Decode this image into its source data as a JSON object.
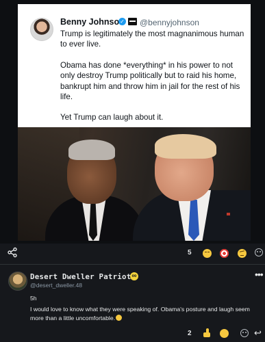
{
  "tweet": {
    "author_name": "Benny Johnson",
    "author_handle": "@bennyjohnson",
    "verified_icon": "verified-check-icon",
    "paragraphs": [
      "Trump is legitimately the most magnanimous human to ever live.",
      "Obama has done *everything* in his power to not only destroy Trump politically but to raid his home, bankrupt him and throw him in jail for the rest of his life.",
      "Yet Trump can laugh about it."
    ]
  },
  "post_actions": {
    "share_icon": "share-icon",
    "reaction_count": "5",
    "reactions": [
      "unamused-face-emoji",
      "target-emoji",
      "raised-eyebrow-emoji"
    ],
    "add_reaction_icon": "add-reaction-icon"
  },
  "comment": {
    "author_name": "Desert Dweller Patriot",
    "author_handle": "@desert_dweller.48",
    "badge_symbol": "∞",
    "time": "5h",
    "text": "I would love to know what they were speaking of. Obama's posture and laugh seem more than a little uncomfortable.",
    "more_symbol": "•••",
    "reaction_count": "2",
    "reactions": [
      "thumbs-up-emoji",
      "unamused-face-emoji",
      "raised-eyebrow-emoji"
    ],
    "reply_symbol": "↩"
  },
  "colors": {
    "background": "#16181c",
    "text": "#e7e9ea",
    "muted": "#8b98a5",
    "verified": "#1d9bf0",
    "badge": "#f3d33c"
  }
}
